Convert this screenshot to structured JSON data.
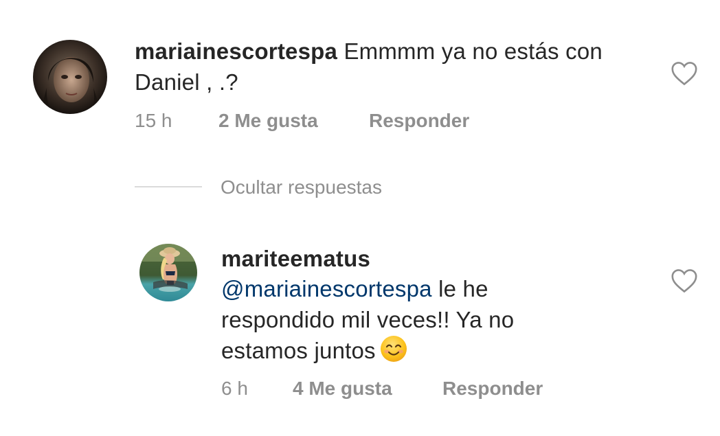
{
  "comments": [
    {
      "username": "mariainescortespa",
      "text": "Emmmm ya no estás con Daniel , .?",
      "time": "15 h",
      "likes": "2 Me gusta",
      "reply_label": "Responder",
      "liked": false
    }
  ],
  "replies_toggle": {
    "label": "Ocultar respuestas"
  },
  "replies": [
    {
      "username": "mariteematus",
      "mention": "@mariainescortespa",
      "text_line1": " le he",
      "text_line2": "respondido mil veces!! Ya no",
      "text_line3": "estamos juntos",
      "emoji": "smiling-face-with-smiling-eyes",
      "time": "6 h",
      "likes": "4 Me gusta",
      "reply_label": "Responder",
      "liked": false
    }
  ],
  "colors": {
    "text": "#262626",
    "meta": "#8e8e8e",
    "mention": "#00376b",
    "divider": "#dbdbdb"
  }
}
